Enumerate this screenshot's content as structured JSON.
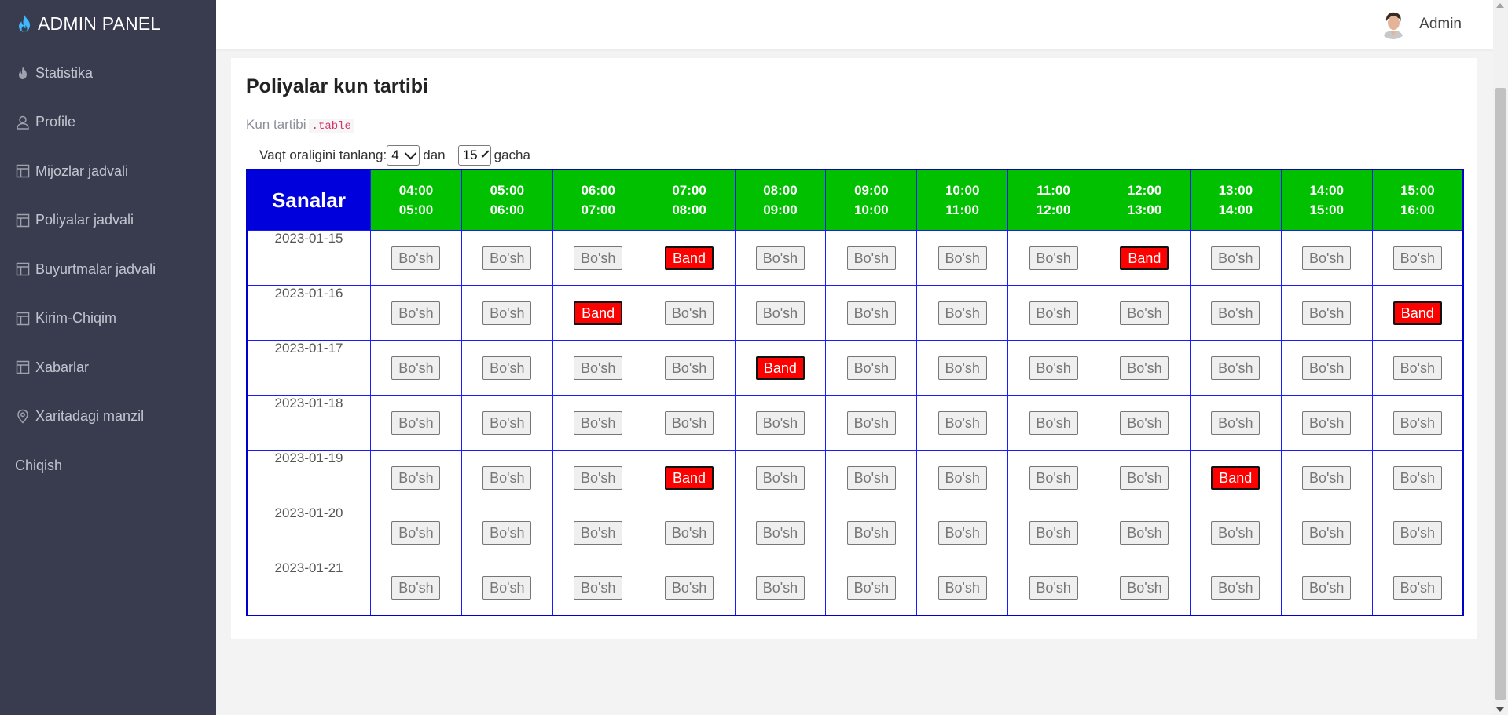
{
  "brand": {
    "title": "ADMIN PANEL"
  },
  "sidebar": {
    "items": [
      {
        "label": "Statistika",
        "icon": "fire-icon"
      },
      {
        "label": "Profile",
        "icon": "user-icon"
      },
      {
        "label": "Mijozlar jadvali",
        "icon": "table-icon"
      },
      {
        "label": "Poliyalar jadvali",
        "icon": "table-icon"
      },
      {
        "label": "Buyurtmalar jadvali",
        "icon": "table-icon"
      },
      {
        "label": "Kirim-Chiqim",
        "icon": "table-icon"
      },
      {
        "label": "Xabarlar",
        "icon": "table-icon"
      },
      {
        "label": "Xaritadagi manzil",
        "icon": "map-pin-icon"
      }
    ],
    "logout": "Chiqish"
  },
  "header": {
    "user_name": "Admin"
  },
  "page": {
    "title": "Poliyalar kun tartibi",
    "subtitle": "Kun tartibi",
    "subtitle_code": ".table"
  },
  "filter": {
    "label": "Vaqt oraligini tanlang:",
    "from_value": "4",
    "from_suffix": "dan",
    "to_value": "15",
    "to_suffix": "gacha"
  },
  "table": {
    "dates_header": "Sanalar",
    "slots": [
      [
        "04:00",
        "05:00"
      ],
      [
        "05:00",
        "06:00"
      ],
      [
        "06:00",
        "07:00"
      ],
      [
        "07:00",
        "08:00"
      ],
      [
        "08:00",
        "09:00"
      ],
      [
        "09:00",
        "10:00"
      ],
      [
        "10:00",
        "11:00"
      ],
      [
        "11:00",
        "12:00"
      ],
      [
        "12:00",
        "13:00"
      ],
      [
        "13:00",
        "14:00"
      ],
      [
        "14:00",
        "15:00"
      ],
      [
        "15:00",
        "16:00"
      ]
    ],
    "free_label": "Bo'sh",
    "busy_label": "Band",
    "rows": [
      {
        "date": "2023-01-15",
        "status": [
          "free",
          "free",
          "free",
          "busy",
          "free",
          "free",
          "free",
          "free",
          "busy",
          "free",
          "free",
          "free"
        ]
      },
      {
        "date": "2023-01-16",
        "status": [
          "free",
          "free",
          "busy",
          "free",
          "free",
          "free",
          "free",
          "free",
          "free",
          "free",
          "free",
          "busy"
        ]
      },
      {
        "date": "2023-01-17",
        "status": [
          "free",
          "free",
          "free",
          "free",
          "busy",
          "free",
          "free",
          "free",
          "free",
          "free",
          "free",
          "free"
        ]
      },
      {
        "date": "2023-01-18",
        "status": [
          "free",
          "free",
          "free",
          "free",
          "free",
          "free",
          "free",
          "free",
          "free",
          "free",
          "free",
          "free"
        ]
      },
      {
        "date": "2023-01-19",
        "status": [
          "free",
          "free",
          "free",
          "busy",
          "free",
          "free",
          "free",
          "free",
          "free",
          "busy",
          "free",
          "free"
        ]
      },
      {
        "date": "2023-01-20",
        "status": [
          "free",
          "free",
          "free",
          "free",
          "free",
          "free",
          "free",
          "free",
          "free",
          "free",
          "free",
          "free"
        ]
      },
      {
        "date": "2023-01-21",
        "status": [
          "free",
          "free",
          "free",
          "free",
          "free",
          "free",
          "free",
          "free",
          "free",
          "free",
          "free",
          "free"
        ]
      }
    ]
  },
  "colors": {
    "sidebar_bg": "#383c4e",
    "brand_icon": "#3fb8ff",
    "dates_header_bg": "#0000dd",
    "slot_header_bg": "#00c000",
    "grid_border": "#1a1aff",
    "busy_bg": "#ff0000"
  }
}
